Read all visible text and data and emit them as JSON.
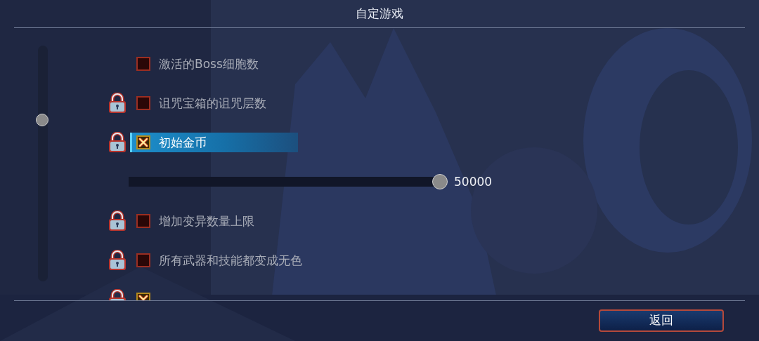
{
  "window": {
    "title": "自定游戏"
  },
  "options": [
    {
      "kind": "toggle",
      "label": "激活的Boss细胞数",
      "locked": false,
      "checked": false,
      "selected": false
    },
    {
      "kind": "toggle",
      "label": "诅咒宝箱的诅咒层数",
      "locked": true,
      "checked": false,
      "selected": false
    },
    {
      "kind": "toggle",
      "label": "初始金币",
      "locked": true,
      "checked": true,
      "selected": true
    },
    {
      "kind": "slider",
      "level": 1.0,
      "reading": "50000"
    },
    {
      "kind": "toggle",
      "label": "增加变异数量上限",
      "locked": true,
      "checked": false,
      "selected": false
    },
    {
      "kind": "toggle",
      "label": "所有武器和技能都变成无色",
      "locked": true,
      "checked": false,
      "selected": false
    },
    {
      "kind": "toggle",
      "locked": true,
      "checked": true,
      "selected": false
    }
  ],
  "buttons": [
    {
      "label": "返回"
    }
  ]
}
